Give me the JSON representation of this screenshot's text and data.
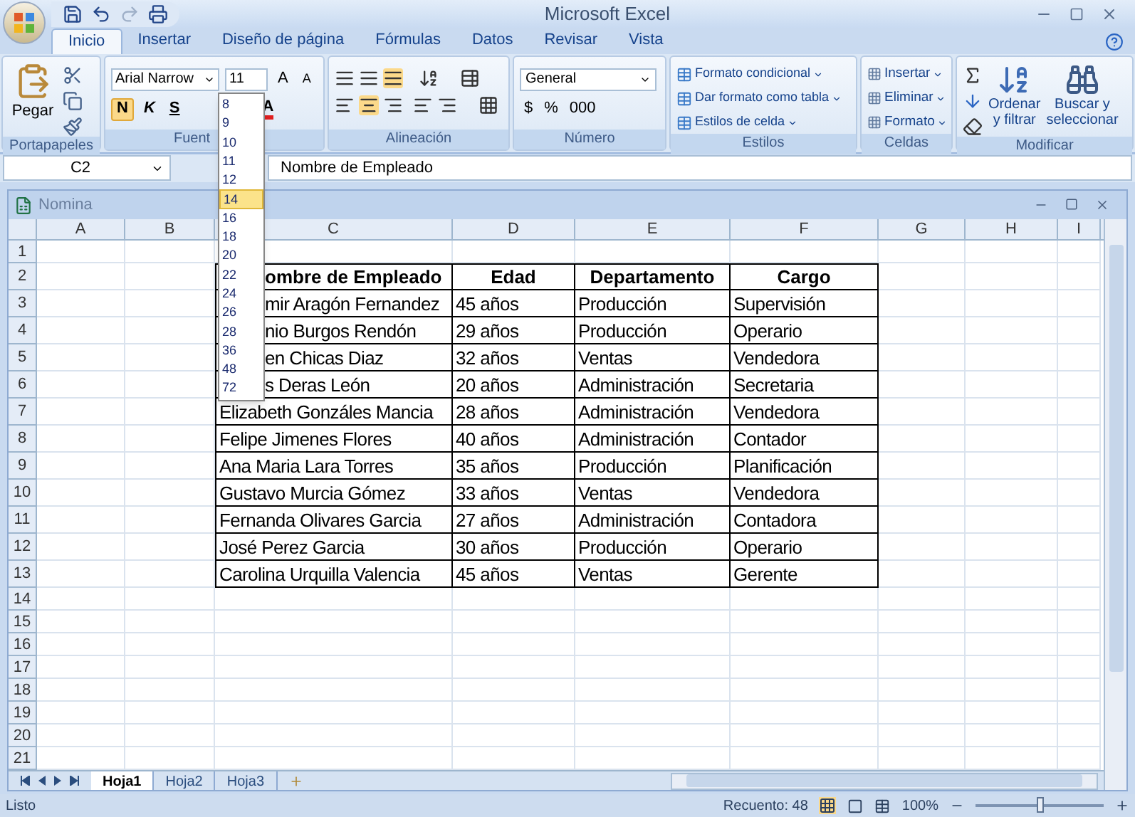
{
  "window": {
    "title": "Microsoft Excel"
  },
  "tabs": [
    {
      "label": "Inicio",
      "selected": true
    },
    {
      "label": "Insertar",
      "selected": false
    },
    {
      "label": "Diseño de página",
      "selected": false
    },
    {
      "label": "Fórmulas",
      "selected": false
    },
    {
      "label": "Datos",
      "selected": false
    },
    {
      "label": "Revisar",
      "selected": false
    },
    {
      "label": "Vista",
      "selected": false
    }
  ],
  "ribbon": {
    "clipboard": {
      "paste": "Pegar",
      "group": "Portapapeles"
    },
    "font": {
      "name": "Arial Narrow",
      "size": "11",
      "grow": "A",
      "shrink": "A",
      "bold": "N",
      "italic": "K",
      "underline": "S",
      "color_label": "A",
      "group": "Fuent"
    },
    "alignment": {
      "group": "Alineación"
    },
    "number": {
      "format": "General",
      "currency": "$",
      "percent": "%",
      "thousands": "000",
      "group": "Número"
    },
    "styles": {
      "items": [
        "Formato condicional",
        "Dar formato como tabla",
        "Estilos de celda"
      ],
      "group": "Estilos"
    },
    "cells": {
      "items": [
        "Insertar",
        "Eliminar",
        "Formato"
      ],
      "group": "Celdas"
    },
    "editing": {
      "sort": [
        "Ordenar",
        "y filtrar"
      ],
      "find": [
        "Buscar y",
        "seleccionar"
      ],
      "group": "Modificar"
    }
  },
  "formula_bar": {
    "cell_ref": "C2",
    "value": "Nombre de Empleado"
  },
  "font_size_list": [
    {
      "label": "8",
      "selected": false
    },
    {
      "label": "9",
      "selected": false
    },
    {
      "label": "10",
      "selected": false
    },
    {
      "label": "11",
      "selected": false
    },
    {
      "label": "12",
      "selected": false
    },
    {
      "label": "14",
      "selected": true
    },
    {
      "label": "16",
      "selected": false
    },
    {
      "label": "18",
      "selected": false
    },
    {
      "label": "20",
      "selected": false
    },
    {
      "label": "22",
      "selected": false
    },
    {
      "label": "24",
      "selected": false
    },
    {
      "label": "26",
      "selected": false
    },
    {
      "label": "28",
      "selected": false
    },
    {
      "label": "36",
      "selected": false
    },
    {
      "label": "48",
      "selected": false
    },
    {
      "label": "72",
      "selected": false
    }
  ],
  "workbook": {
    "title": "Nomina",
    "columns": [
      "A",
      "B",
      "C",
      "D",
      "E",
      "F",
      "G",
      "H",
      "I"
    ],
    "rows": [
      {
        "number": "1"
      },
      {
        "number": "2",
        "header": true,
        "values": [
          "ombre de Empleado",
          "Edad",
          "Departamento",
          "Cargo"
        ]
      },
      {
        "number": "3",
        "header": false,
        "values": [
          "mir Aragón Fernandez",
          "45 años",
          "Producción",
          "Supervisión"
        ]
      },
      {
        "number": "4",
        "header": false,
        "values": [
          "nio Burgos Rendón",
          "29 años",
          "Producción",
          "Operario"
        ]
      },
      {
        "number": "5",
        "header": false,
        "values": [
          "en Chicas Diaz",
          "32 años",
          "Ventas",
          "Vendedora"
        ]
      },
      {
        "number": "6",
        "header": false,
        "values": [
          "s Deras León",
          "20 años",
          "Administración",
          "Secretaria"
        ]
      },
      {
        "number": "7",
        "header": false,
        "values": [
          "Elizabeth Gonzáles Mancia",
          "28 años",
          "Administración",
          "Vendedora"
        ]
      },
      {
        "number": "8",
        "header": false,
        "values": [
          "Felipe Jimenes Flores",
          "40 años",
          "Administración",
          "Contador"
        ]
      },
      {
        "number": "9",
        "header": false,
        "values": [
          "Ana Maria Lara Torres",
          "35 años",
          "Producción",
          "Planificación"
        ]
      },
      {
        "number": "10",
        "header": false,
        "values": [
          "Gustavo Murcia Gómez",
          "33 años",
          "Ventas",
          "Vendedora"
        ]
      },
      {
        "number": "11",
        "header": false,
        "values": [
          "Fernanda Olivares Garcia",
          "27 años",
          "Administración",
          "Contadora"
        ]
      },
      {
        "number": "12",
        "header": false,
        "values": [
          "José Perez Garcia",
          "30 años",
          "Producción",
          "Operario"
        ]
      },
      {
        "number": "13",
        "header": false,
        "values": [
          "Carolina Urquilla Valencia",
          "45 años",
          "Ventas",
          "Gerente"
        ]
      },
      {
        "number": "14"
      },
      {
        "number": "15"
      },
      {
        "number": "16"
      },
      {
        "number": "17"
      },
      {
        "number": "18"
      },
      {
        "number": "19"
      },
      {
        "number": "20"
      },
      {
        "number": "21"
      }
    ],
    "sheets": [
      {
        "label": "Hoja1",
        "selected": true
      },
      {
        "label": "Hoja2",
        "selected": false
      },
      {
        "label": "Hoja3",
        "selected": false
      }
    ]
  },
  "status_bar": {
    "state": "Listo",
    "count": "Recuento: 48",
    "zoom": "100%",
    "zoom_slider": {
      "level": 0.5
    }
  }
}
